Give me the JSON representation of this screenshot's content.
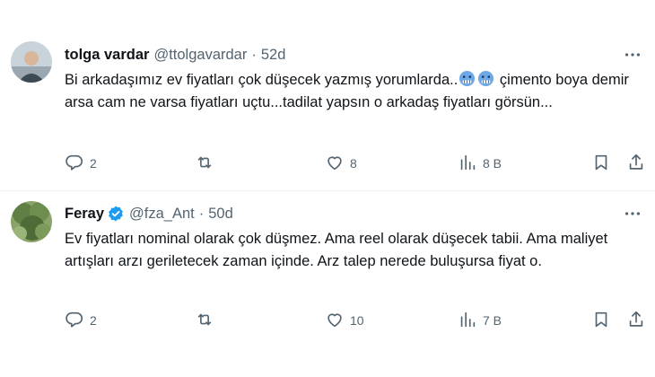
{
  "tweets": [
    {
      "display_name": "tolga vardar",
      "handle": "@ttolgavardar",
      "separator": "·",
      "time": "52d",
      "verified": false,
      "text_before_emoji": "Bi arkadaşımız ev fiyatları çok düşecek yazmış yorumlarda..",
      "emoji": [
        "cold-face-emoji",
        "cold-face-emoji"
      ],
      "text_after_emoji": " çimento boya demir arsa cam ne varsa fiyatları uçtu...tadilat yapsın o arkadaş fiyatları görsün...",
      "replies": "2",
      "retweets": "",
      "likes": "8",
      "views": "8 B",
      "avatar": "user-avatar"
    },
    {
      "display_name": "Feray",
      "handle": "@fza_Ant",
      "separator": "·",
      "time": "50d",
      "verified": true,
      "text": "Ev fiyatları nominal olarak çok düşmez. Ama reel olarak düşecek tabii. Ama maliyet artışları arzı geriletecek zaman içinde. Arz talep nerede buluşursa fiyat o.",
      "replies": "2",
      "retweets": "",
      "likes": "10",
      "views": "7 B",
      "avatar": "nature-avatar"
    }
  ],
  "icons": {
    "reply": "reply-icon",
    "retweet": "retweet-icon",
    "like": "heart-icon",
    "views": "views-icon",
    "bookmark": "bookmark-icon",
    "share": "share-icon",
    "more": "more-icon",
    "verified": "verified-badge-icon"
  },
  "colors": {
    "text": "#0f1419",
    "secondary": "#536471",
    "divider": "#eff3f4",
    "verified": "#1d9bf0",
    "emoji": "#7fb3e8"
  }
}
